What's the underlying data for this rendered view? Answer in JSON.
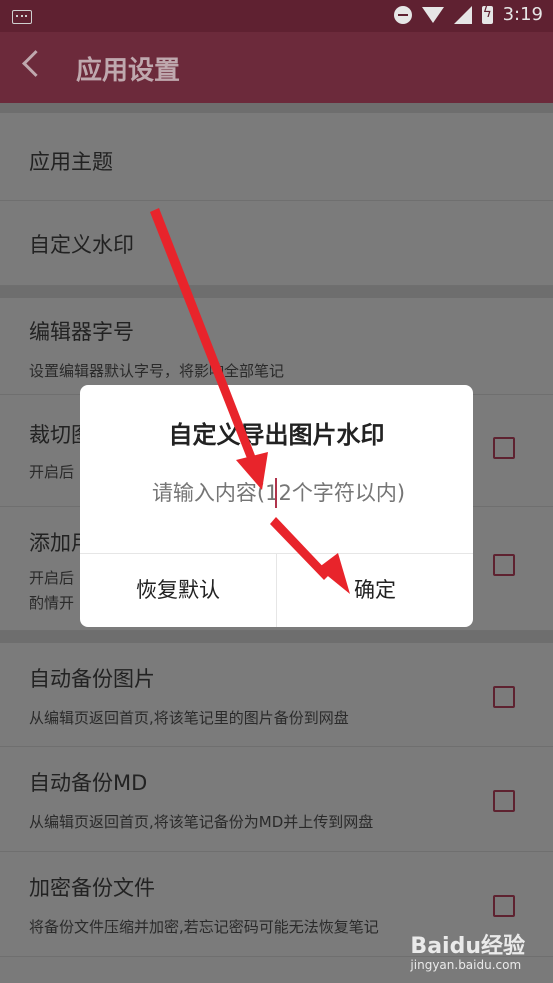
{
  "status_bar": {
    "time": "3:19"
  },
  "app_bar": {
    "title": "应用设置"
  },
  "settings": {
    "app_theme": "应用主题",
    "custom_watermark": "自定义水印",
    "editor_font_size": {
      "label": "编辑器字号",
      "desc": "设置编辑器默认字号，将影响全部笔记"
    },
    "crop": {
      "label": "裁切图",
      "desc": "开启后"
    },
    "add": {
      "label": "添加用",
      "desc_line1": "开启后",
      "desc_line2": "酌情开"
    },
    "auto_backup_images": {
      "label": "自动备份图片",
      "desc": "从编辑页返回首页,将该笔记里的图片备份到网盘"
    },
    "auto_backup_md": {
      "label": "自动备份MD",
      "desc": "从编辑页返回首页,将该笔记备份为MD并上传到网盘"
    },
    "encrypt_backup": {
      "label": "加密备份文件",
      "desc": "将备份文件压缩并加密,若忘记密码可能无法恢复笔记"
    }
  },
  "dialog": {
    "title": "自定义导出图片水印",
    "placeholder": "请输入内容(12个字符以内)",
    "reset_label": "恢复默认",
    "confirm_label": "确定"
  },
  "watermark": {
    "brand": "Baidu经验",
    "url": "jingyan.baidu.com"
  },
  "colors": {
    "accent": "#b0344c",
    "app_bar": "#6c2a3b",
    "status_bar": "#5f2131",
    "arrow": "#e8242b"
  }
}
